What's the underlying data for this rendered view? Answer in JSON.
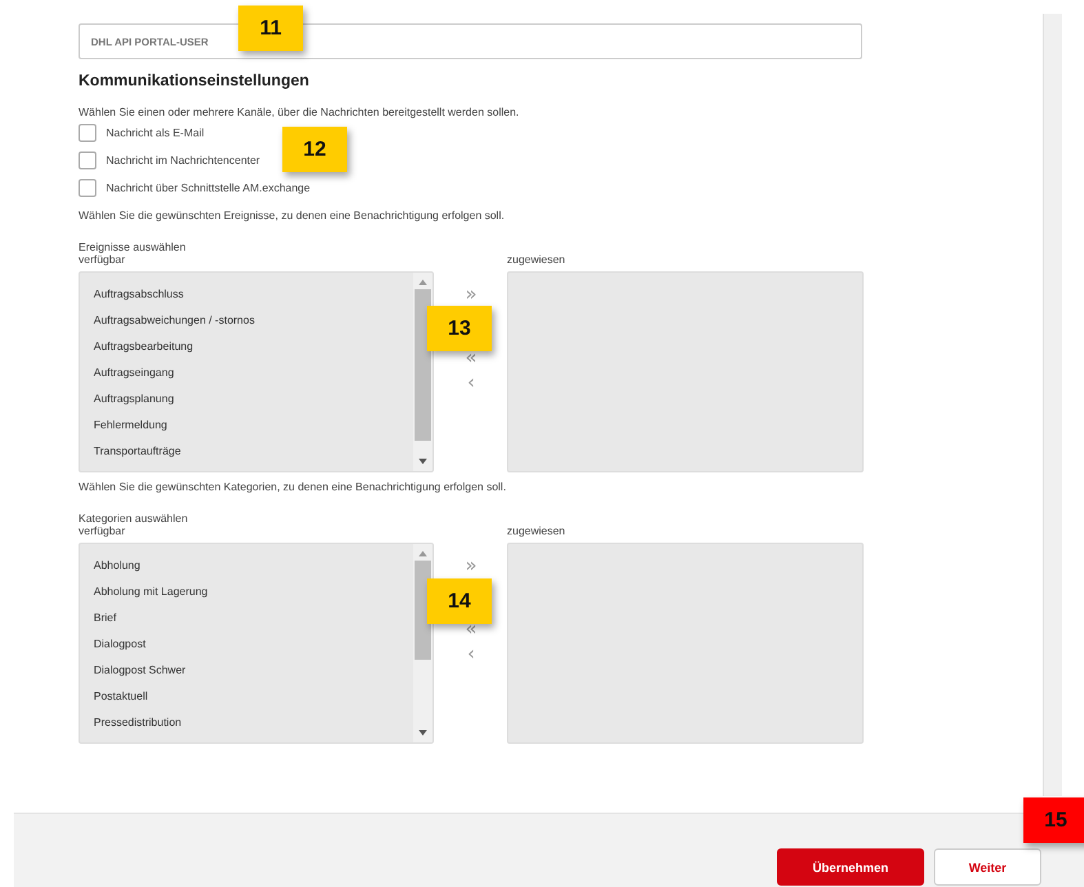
{
  "user_field": {
    "value": "DHL API PORTAL-USER"
  },
  "heading": "Kommunikationseinstellungen",
  "channels_hint": "Wählen Sie einen oder mehrere Kanäle, über die Nachrichten bereitgestellt werden sollen.",
  "channels": [
    {
      "label": "Nachricht als E-Mail",
      "checked": false
    },
    {
      "label": "Nachricht im Nachrichtencenter",
      "checked": false
    },
    {
      "label": "Nachricht über Schnittstelle AM.exchange",
      "checked": false
    }
  ],
  "pickers": [
    {
      "hint": "Wählen Sie die gewünschten Ereignisse, zu denen eine Benachrichtigung erfolgen soll.",
      "title": "Ereignisse auswählen",
      "available_label": "verfügbar",
      "assigned_label": "zugewiesen",
      "available": [
        "Auftragsabschluss",
        "Auftragsabweichungen / -stornos",
        "Auftragsbearbeitung",
        "Auftragseingang",
        "Auftragsplanung",
        "Fehlermeldung",
        "Transportaufträge"
      ],
      "move_buttons": [
        "»",
        "«",
        "‹"
      ]
    },
    {
      "hint": "Wählen Sie die gewünschten Kategorien, zu denen eine Benachrichtigung erfolgen soll.",
      "title": "Kategorien auswählen",
      "available_label": "verfügbar",
      "assigned_label": "zugewiesen",
      "available": [
        "Abholung",
        "Abholung mit Lagerung",
        "Brief",
        "Dialogpost",
        "Dialogpost Schwer",
        "Postaktuell",
        "Pressedistribution"
      ],
      "move_buttons": [
        "»",
        "«",
        "‹"
      ]
    }
  ],
  "buttons": [
    {
      "label": "Übernehmen",
      "kind": "primary"
    },
    {
      "label": "Weiter",
      "kind": "secondary"
    }
  ],
  "callouts": [
    {
      "label": "11",
      "color": "#ffcc00"
    },
    {
      "label": "12",
      "color": "#ffcc00"
    },
    {
      "label": "13",
      "color": "#ffcc00"
    },
    {
      "label": "14",
      "color": "#ffcc00"
    },
    {
      "label": "15",
      "color": "#ff0000"
    }
  ]
}
